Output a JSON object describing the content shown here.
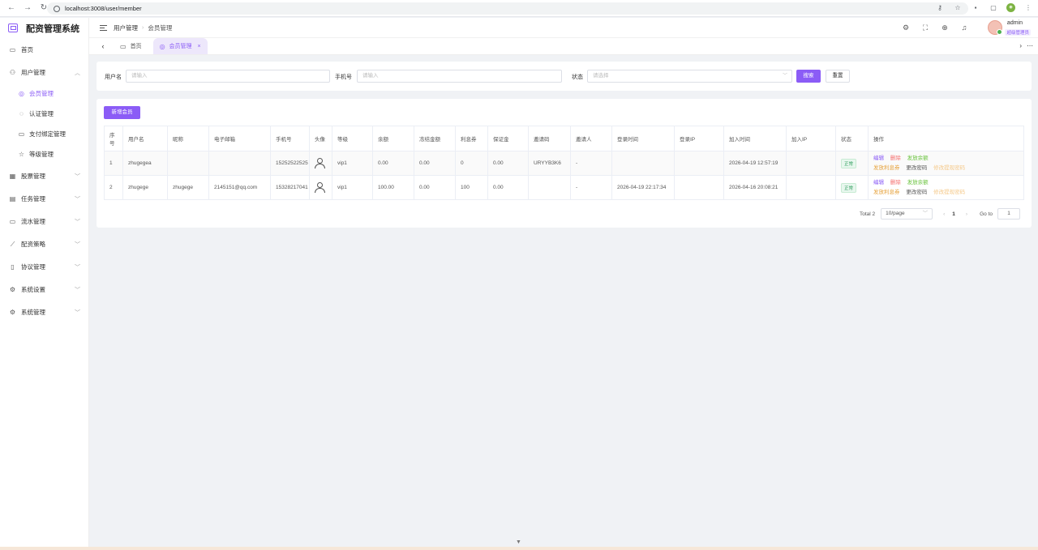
{
  "browser": {
    "url": "localhost:3008/user/member"
  },
  "app": {
    "title": "配资管理系统"
  },
  "sidebar": {
    "home": "首页",
    "user_mgmt": "用户管理",
    "sub": [
      "会员管理",
      "认证管理",
      "支付绑定管理",
      "等级管理"
    ],
    "groups": [
      "股票管理",
      "任务管理",
      "流水管理",
      "配资策略",
      "协议管理",
      "系统设置",
      "系统管理"
    ]
  },
  "header": {
    "crumb1": "用户管理",
    "crumb2": "会员管理",
    "user_name": "admin",
    "user_role": "超级管理员"
  },
  "tabs": {
    "home": "首页",
    "member": "会员管理"
  },
  "search": {
    "username_label": "用户名",
    "username_placeholder": "请输入",
    "phone_label": "手机号",
    "phone_placeholder": "请输入",
    "status_label": "状态",
    "status_placeholder": "请选择",
    "search_btn": "搜索",
    "reset_btn": "重置"
  },
  "table": {
    "add_btn": "新增会员",
    "columns": [
      "序号",
      "用户名",
      "昵称",
      "电子邮箱",
      "手机号",
      "头像",
      "等级",
      "余额",
      "冻结金额",
      "利息券",
      "保证金",
      "邀请码",
      "邀请人",
      "登录时间",
      "登录IP",
      "加入时间",
      "加入IP",
      "状态",
      "操作"
    ],
    "rows": [
      [
        "1",
        "zhugegea",
        "",
        "",
        "15252522525",
        "",
        "vip1",
        "0.00",
        "0.00",
        "0",
        "0.00",
        "URYYB3K6",
        "-",
        "",
        "",
        "2026-04-19 12:57:19",
        "",
        "正常"
      ],
      [
        "2",
        "zhugege",
        "zhugege",
        "2145151@qq.com",
        "15328217041",
        "",
        "vip1",
        "100.00",
        "0.00",
        "100",
        "0.00",
        "",
        "-",
        "2026-04-19 22:17:34",
        "",
        "2026-04-16 20:08:21",
        "",
        "正常"
      ]
    ],
    "ops": {
      "edit": "编辑",
      "delete": "删除",
      "issue_balance": "发放余额",
      "issue_coupon": "发放利息券",
      "change_pwd": "更改密码",
      "change_withdraw_pwd": "修改提现密码"
    }
  },
  "pager": {
    "total": "Total 2",
    "size": "10/page",
    "page": "1",
    "goto": "Go to",
    "goto_value": "1"
  }
}
